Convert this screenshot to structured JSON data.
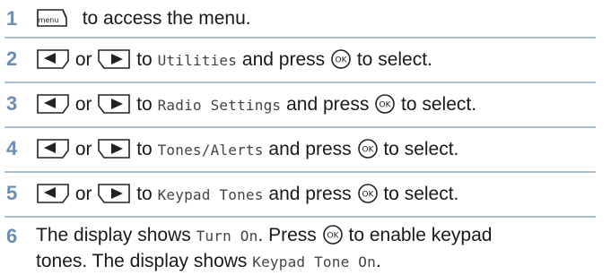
{
  "colors": {
    "step_number": "#6a8fb4",
    "divider": "#a9bfd6",
    "text": "#1a1a1a"
  },
  "icons": {
    "menu_key": "menu-key-icon",
    "left_key": "left-arrow-key-icon",
    "right_key": "right-arrow-key-icon",
    "ok_key": "ok-key-icon"
  },
  "steps": [
    {
      "number": "1",
      "menu_label": "menu",
      "text": "to access the menu."
    },
    {
      "number": "2",
      "or": "or",
      "to": "to",
      "item": "Utilities",
      "and": "and press",
      "end": "to select."
    },
    {
      "number": "3",
      "or": "or",
      "to": "to",
      "item": "Radio Settings",
      "and": "and press",
      "end": "to select."
    },
    {
      "number": "4",
      "or": "or",
      "to": "to",
      "item": "Tones/Alerts",
      "and": "and press",
      "end": "to select."
    },
    {
      "number": "5",
      "or": "or",
      "to": "to",
      "item": "Keypad Tones",
      "and": "and press",
      "end": "to select."
    },
    {
      "number": "6",
      "line1_a": "The display shows",
      "display1": "Turn On",
      "line1_b": ". Press",
      "line1_c": "to enable keypad",
      "line2_a": "tones. The display shows",
      "display2": "Keypad Tone On",
      "line2_b": "."
    }
  ]
}
